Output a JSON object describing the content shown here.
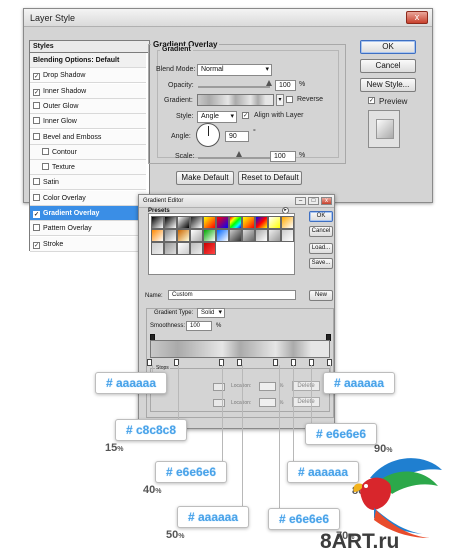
{
  "layer_style": {
    "title": "Layer Style",
    "close_label": "x",
    "styles_header": "Styles",
    "items": [
      {
        "label": "Blending Options: Default",
        "checkbox": false,
        "checked": false,
        "selected": false,
        "indent": false
      },
      {
        "label": "Drop Shadow",
        "checkbox": true,
        "checked": true,
        "selected": false,
        "indent": false
      },
      {
        "label": "Inner Shadow",
        "checkbox": true,
        "checked": true,
        "selected": false,
        "indent": false
      },
      {
        "label": "Outer Glow",
        "checkbox": true,
        "checked": false,
        "selected": false,
        "indent": false
      },
      {
        "label": "Inner Glow",
        "checkbox": true,
        "checked": false,
        "selected": false,
        "indent": false
      },
      {
        "label": "Bevel and Emboss",
        "checkbox": true,
        "checked": false,
        "selected": false,
        "indent": false
      },
      {
        "label": "Contour",
        "checkbox": true,
        "checked": false,
        "selected": false,
        "indent": true
      },
      {
        "label": "Texture",
        "checkbox": true,
        "checked": false,
        "selected": false,
        "indent": true
      },
      {
        "label": "Satin",
        "checkbox": true,
        "checked": false,
        "selected": false,
        "indent": false
      },
      {
        "label": "Color Overlay",
        "checkbox": true,
        "checked": false,
        "selected": false,
        "indent": false
      },
      {
        "label": "Gradient Overlay",
        "checkbox": true,
        "checked": true,
        "selected": true,
        "indent": false
      },
      {
        "label": "Pattern Overlay",
        "checkbox": true,
        "checked": false,
        "selected": false,
        "indent": false
      },
      {
        "label": "Stroke",
        "checkbox": true,
        "checked": true,
        "selected": false,
        "indent": false
      }
    ],
    "section_title": "Gradient Overlay",
    "sub_title": "Gradient",
    "blend_mode_label": "Blend Mode:",
    "blend_mode_value": "Normal",
    "opacity_label": "Opacity:",
    "opacity_value": "100",
    "opacity_unit": "%",
    "gradient_label": "Gradient:",
    "reverse_label": "Reverse",
    "style_label": "Style:",
    "style_value": "Angle",
    "align_label": "Align with Layer",
    "angle_label": "Angle:",
    "angle_value": "90",
    "angle_unit": "°",
    "scale_label": "Scale:",
    "scale_value": "100",
    "scale_unit": "%",
    "make_default": "Make Default",
    "reset_default": "Reset to Default",
    "ok": "OK",
    "cancel": "Cancel",
    "new_style": "New Style...",
    "preview_label": "Preview"
  },
  "gradient_editor": {
    "title": "Gradient Editor",
    "presets_label": "Presets",
    "ok": "OK",
    "cancel": "Cancel",
    "load": "Load...",
    "save": "Save...",
    "name_label": "Name:",
    "name_value": "Custom",
    "new_label": "New",
    "type_label": "Gradient Type:",
    "type_value": "Solid",
    "smoothness_label": "Smoothness:",
    "smoothness_value": "100",
    "smoothness_unit": "%",
    "stops_label": "Stops",
    "opacity_label": "Opacity:",
    "location_label": "Location:",
    "color_label": "Color:",
    "delete_label": "Delete",
    "pct": "%"
  },
  "callouts": [
    {
      "color": "# aaaaaa",
      "pct": "",
      "hex": "#aaaaaa"
    },
    {
      "color": "# c8c8c8",
      "pct": "15",
      "hex": "#c8c8c8"
    },
    {
      "color": "# e6e6e6",
      "pct": "40",
      "hex": "#e6e6e6"
    },
    {
      "color": "# aaaaaa",
      "pct": "50",
      "hex": "#aaaaaa"
    },
    {
      "color": "# e6e6e6",
      "pct": "70",
      "hex": "#e6e6e6"
    },
    {
      "color": "# aaaaaa",
      "pct": "80",
      "hex": "#aaaaaa"
    },
    {
      "color": "# e6e6e6",
      "pct": "90",
      "hex": "#e6e6e6"
    },
    {
      "color": "# aaaaaa",
      "pct": "",
      "hex": "#aaaaaa"
    }
  ],
  "pct_suffix": "%",
  "watermark": "8ART.ru",
  "colors": {
    "accent": "#3a8ee6",
    "callout_text": "#4aa3e8",
    "close": "#c8412d"
  }
}
